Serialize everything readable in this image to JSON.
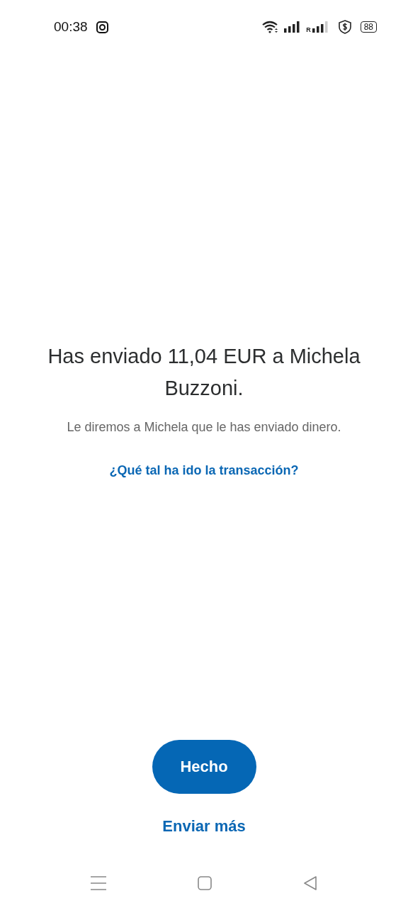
{
  "status_bar": {
    "time": "00:38",
    "signal_label": "R",
    "battery": "88"
  },
  "message": {
    "title": "Has enviado 11,04 EUR a Michela Buzzoni.",
    "subtitle": "Le diremos a Michela que le has enviado dinero.",
    "link": "¿Qué tal ha ido la transacción?"
  },
  "actions": {
    "primary": "Hecho",
    "secondary": "Enviar más"
  }
}
